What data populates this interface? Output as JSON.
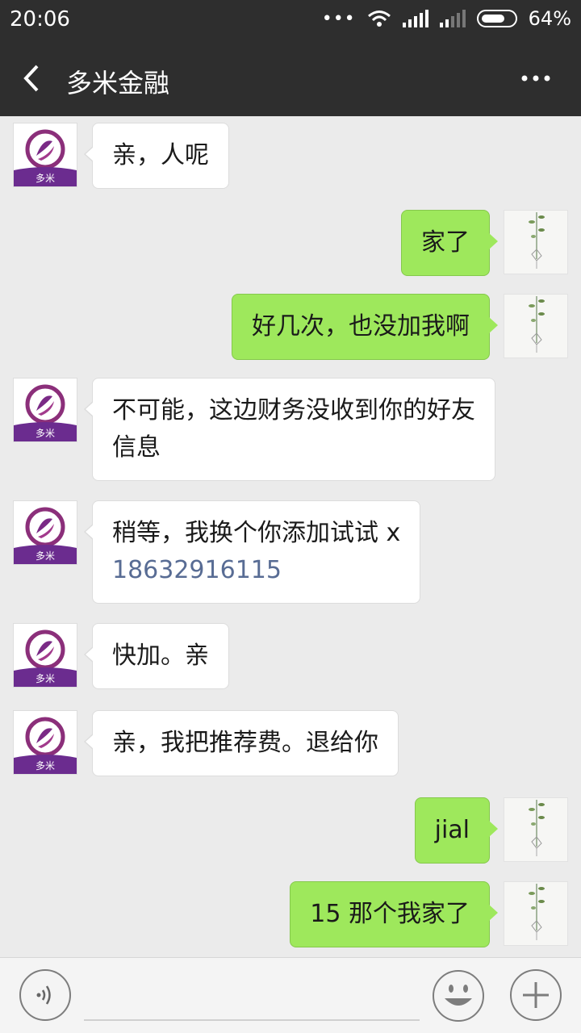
{
  "status_bar": {
    "time": "20:06",
    "battery": "64%"
  },
  "header": {
    "title": "多米金融"
  },
  "logo_text": "多米",
  "messages": [
    {
      "from": "them",
      "text": "亲，人呢"
    },
    {
      "from": "me",
      "text": "家了"
    },
    {
      "from": "me",
      "text": "好几次，也没加我啊"
    },
    {
      "from": "them",
      "line1": "不可能，这边财务没收到你的好友",
      "line2": "信息"
    },
    {
      "from": "them",
      "line1": "稍等，我换个你添加试试 x",
      "phone": "18632916115"
    },
    {
      "from": "them",
      "text": "快加。亲"
    },
    {
      "from": "them",
      "text": "亲，我把推荐费。退给你"
    },
    {
      "from": "me",
      "text": "jial"
    },
    {
      "from": "me",
      "text": "15 那个我家了"
    }
  ],
  "colors": {
    "bar": "#2e2e2e",
    "chat_bg": "#ebebeb",
    "out_bubble": "#9ee85c",
    "in_bubble": "#ffffff",
    "link": "#586c94"
  },
  "icons": [
    "back-arrow-icon",
    "more-options-icon",
    "voice-icon",
    "emoji-icon",
    "plus-icon",
    "wifi-icon",
    "signal-icon",
    "battery-icon"
  ]
}
